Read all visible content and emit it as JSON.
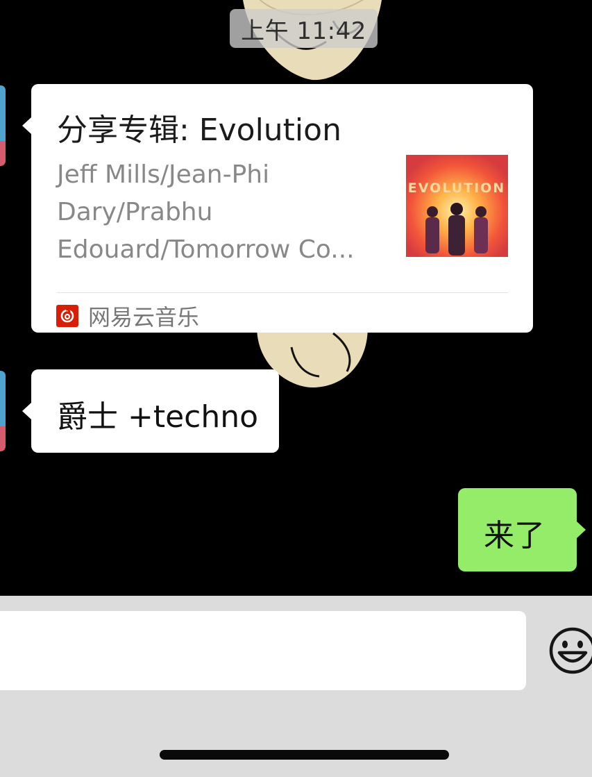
{
  "chat": {
    "timestamp": "上午 11:42",
    "messages": [
      {
        "type": "music_share",
        "title": "分享专辑: Evolution",
        "artist_lines": [
          "Jeff Mills/Jean-Phi",
          "Dary/Prabhu",
          "Edouard/Tomorrow Co..."
        ],
        "source": "网易云音乐",
        "album_art_text": "EVOLUTION"
      },
      {
        "type": "text",
        "from": "other",
        "text": "爵士 +techno"
      },
      {
        "type": "text",
        "from": "me",
        "text": "来了"
      }
    ]
  },
  "input": {
    "value": "",
    "emoji_icon": "smile-icon"
  },
  "colors": {
    "my_bubble": "#95ec69",
    "input_bar": "#dcdcdc",
    "netease_red": "#d81e06"
  }
}
